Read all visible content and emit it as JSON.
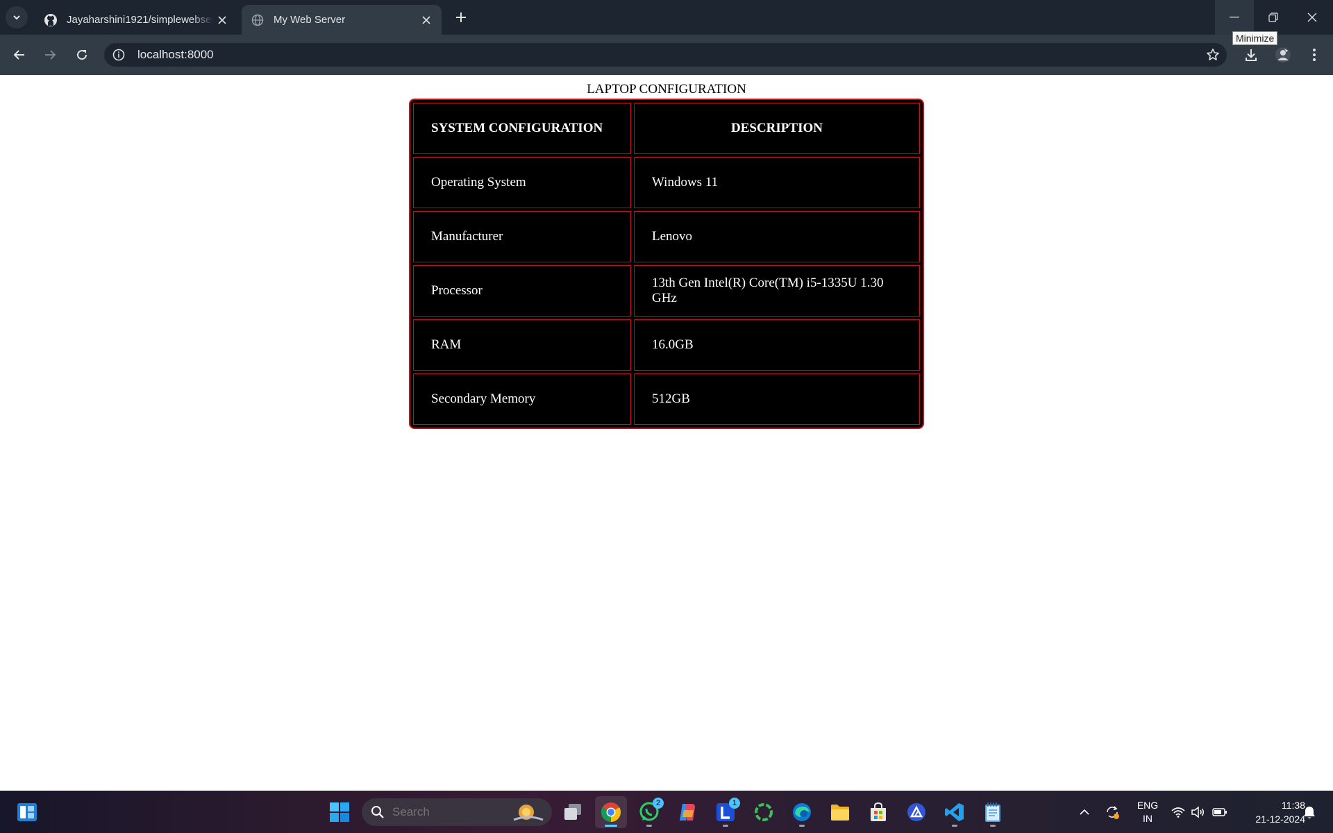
{
  "browser": {
    "tabs": [
      {
        "title": "Jayaharshini1921/simplewebserver",
        "icon": "github-icon",
        "active": false
      },
      {
        "title": "My Web Server",
        "icon": "globe-icon",
        "active": true
      }
    ],
    "address": "localhost:8000",
    "tooltip": "Minimize"
  },
  "page": {
    "heading": "LAPTOP CONFIGURATION",
    "table": {
      "headers": [
        "SYSTEM CONFIGURATION",
        "DESCRIPTION"
      ],
      "rows": [
        [
          "Operating System",
          "Windows 11"
        ],
        [
          "Manufacturer",
          "Lenovo"
        ],
        [
          "Processor",
          "13th Gen Intel(R) Core(TM) i5-1335U 1.30 GHz"
        ],
        [
          "RAM",
          "16.0GB"
        ],
        [
          "Secondary Memory",
          "512GB"
        ]
      ],
      "border_color": "#c8101a",
      "cell_background": "#000000"
    }
  },
  "taskbar": {
    "search_placeholder": "Search",
    "apps": [
      {
        "name": "start",
        "icon": "windows-start-icon"
      },
      {
        "name": "task-view",
        "icon": "task-view-icon"
      },
      {
        "name": "chrome",
        "icon": "chrome-icon",
        "active": true
      },
      {
        "name": "whatsapp",
        "icon": "whatsapp-icon",
        "badge": "2"
      },
      {
        "name": "copilot",
        "icon": "copilot-icon"
      },
      {
        "name": "lenovo",
        "icon": "lenovo-l-icon",
        "badge": "1"
      },
      {
        "name": "ring-app",
        "icon": "green-ring-icon"
      },
      {
        "name": "edge",
        "icon": "edge-icon"
      },
      {
        "name": "file-explorer",
        "icon": "folder-icon"
      },
      {
        "name": "microsoft-store",
        "icon": "store-icon"
      },
      {
        "name": "vpn",
        "icon": "triangle-app-icon"
      },
      {
        "name": "vscode",
        "icon": "vscode-icon"
      },
      {
        "name": "notepad",
        "icon": "notepad-icon"
      }
    ],
    "language": [
      "ENG",
      "IN"
    ],
    "time": "11:38",
    "date": "21-12-2024"
  }
}
